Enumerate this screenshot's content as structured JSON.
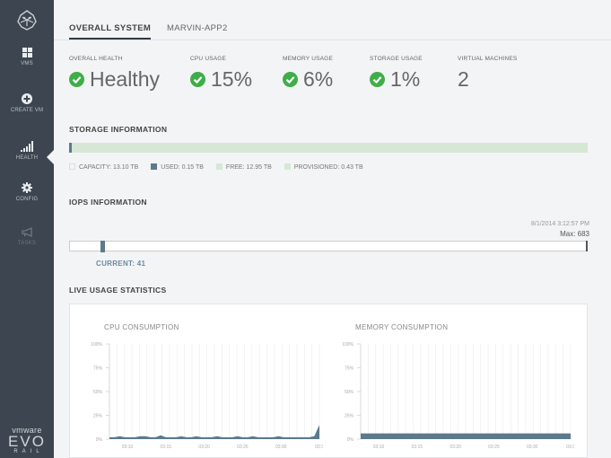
{
  "sidebar": {
    "items": [
      {
        "label": "VMS",
        "icon": "grid-icon"
      },
      {
        "label": "CREATE VM",
        "icon": "plus-circle-icon"
      },
      {
        "label": "HEALTH",
        "icon": "signal-bars-icon"
      },
      {
        "label": "CONFIG",
        "icon": "gear-icon"
      },
      {
        "label": "TASKS",
        "icon": "megaphone-icon"
      }
    ],
    "brand": {
      "vmware": "vmware",
      "evo": "EVO",
      "rail": "RAIL"
    }
  },
  "tabs": [
    {
      "label": "OVERALL SYSTEM",
      "active": true
    },
    {
      "label": "MARVIN-APP2",
      "active": false
    }
  ],
  "stats": [
    {
      "label": "OVERALL HEALTH",
      "value": "Healthy",
      "icon": "check-circle-icon"
    },
    {
      "label": "CPU USAGE",
      "value": "15%",
      "icon": "check-circle-icon"
    },
    {
      "label": "MEMORY USAGE",
      "value": "6%",
      "icon": "check-circle-icon"
    },
    {
      "label": "STORAGE USAGE",
      "value": "1%",
      "icon": "check-circle-icon"
    },
    {
      "label": "VIRTUAL MACHINES",
      "value": "2"
    }
  ],
  "storage": {
    "title": "STORAGE INFORMATION",
    "capacity": "CAPACITY: 13.10 TB",
    "used": "USED: 0.15 TB",
    "free": "FREE: 12.95 TB",
    "provisioned": "PROVISIONED: 0.43 TB",
    "used_fraction": 0.011
  },
  "iops": {
    "title": "IOPS INFORMATION",
    "timestamp": "8/1/2014 3:12:57 PM",
    "max": "Max: 683",
    "current": "CURRENT: 41",
    "current_fraction": 0.06
  },
  "live": {
    "title": "LIVE USAGE STATISTICS",
    "cpu_title": "CPU CONSUMPTION",
    "memory_title": "MEMORY CONSUMPTION"
  },
  "colors": {
    "sidebar": "#3d4650",
    "accent": "#5c7a8c",
    "healthy_green": "#3fae49",
    "free_green": "#d6e7d6"
  },
  "chart_data": [
    {
      "type": "area",
      "title": "CPU CONSUMPTION",
      "x": [
        "03:10",
        "03:15",
        "03:20",
        "03:25",
        "03:30",
        "03:3"
      ],
      "y_ticks": [
        "0%",
        "25%",
        "50%",
        "75%",
        "100%"
      ],
      "ylim": [
        0,
        100
      ],
      "values": [
        2,
        2,
        3,
        2,
        2,
        2,
        3,
        3,
        2,
        2,
        4,
        2,
        2,
        2,
        3,
        2,
        2,
        3,
        2,
        2,
        2,
        3,
        2,
        2,
        2,
        3,
        2,
        2,
        3,
        2,
        2,
        2,
        2,
        3,
        2,
        2,
        2,
        2,
        2,
        2,
        3,
        15
      ]
    },
    {
      "type": "area",
      "title": "MEMORY CONSUMPTION",
      "x": [
        "03:10",
        "03:15",
        "03:20",
        "03:25",
        "03:30",
        "03:3"
      ],
      "y_ticks": [
        "0%",
        "25%",
        "50%",
        "75%",
        "100%"
      ],
      "ylim": [
        0,
        100
      ],
      "values": [
        6,
        6,
        6,
        6,
        6,
        6,
        6,
        6,
        6,
        6,
        6,
        6,
        6,
        6,
        6,
        6,
        6,
        6,
        6,
        6,
        6,
        6,
        6,
        6,
        6,
        6,
        6,
        6,
        6,
        6,
        6,
        6,
        6,
        6,
        6,
        6,
        6,
        6,
        6,
        6,
        6,
        6
      ]
    }
  ]
}
